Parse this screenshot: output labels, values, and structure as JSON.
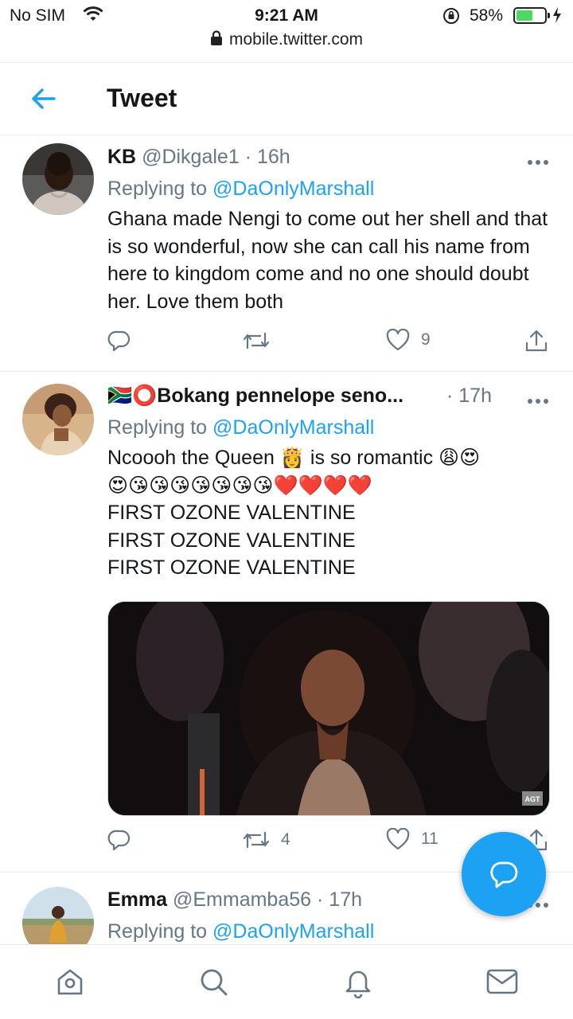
{
  "status_bar": {
    "carrier": "No SIM",
    "time": "9:21 AM",
    "battery_pct": "58%",
    "battery_level": 0.58,
    "icons": [
      "wifi-icon",
      "rotation-lock-icon",
      "battery-icon",
      "charging-bolt-icon"
    ]
  },
  "browser": {
    "url": "mobile.twitter.com"
  },
  "header": {
    "title": "Tweet"
  },
  "tweets": [
    {
      "name": "KB",
      "handle": "@Dikgale1",
      "sep": "·",
      "time": "16h",
      "replying_label": "Replying to",
      "replying_to": "@DaOnlyMarshall",
      "text": "Ghana made Nengi to come out her shell and that is so wonderful, now she can call his name from here to kingdom come and no one should doubt her. Love them both",
      "retweets": "",
      "likes": "9"
    },
    {
      "name_prefix": "🇿🇦⭕",
      "name": "Bokang pennelope seno...",
      "handle": "",
      "sep": "·",
      "time": "17h",
      "replying_label": "Replying to",
      "replying_to": "@DaOnlyMarshall",
      "text_line1": "Ncoooh the  Queen 👸 is so romantic 😩😍",
      "text_line2": "😍😘😘😘😘😘😘😘❤️❤️❤️❤️",
      "text_line3": "FIRST OZONE VALENTINE",
      "text_line4": "FIRST OZONE VALENTINE",
      "text_line5": "FIRST OZONE VALENTINE",
      "media_watermark": "AGT",
      "retweets": "4",
      "likes": "11"
    },
    {
      "name": "Emma",
      "handle": "@Emmamba56",
      "sep": "·",
      "time": "17h",
      "replying_label": "Replying to",
      "replying_to": "@DaOnlyMarshall"
    }
  ],
  "nav": {
    "items": [
      "home-icon",
      "search-icon",
      "notifications-icon",
      "messages-icon"
    ]
  },
  "colors": {
    "accent": "#1da1f2",
    "secondary_text": "#657786",
    "divider": "#e6ecf0"
  }
}
